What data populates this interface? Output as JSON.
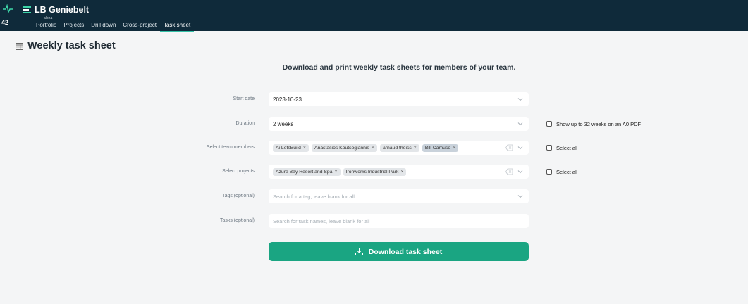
{
  "topbar": {
    "badge": "42",
    "brand": "LB Geniebelt",
    "nav": [
      {
        "label": "Portfolio",
        "tag": "alpha"
      },
      {
        "label": "Projects"
      },
      {
        "label": "Drill down"
      },
      {
        "label": "Cross-project"
      },
      {
        "label": "Task sheet"
      }
    ],
    "active_index": 4
  },
  "header": {
    "title": "Weekly task sheet",
    "subtitle": "Download and print weekly task sheets for members of your team."
  },
  "form": {
    "start_date": {
      "label": "Start date",
      "value": "2023-10-23"
    },
    "duration": {
      "label": "Duration",
      "value": "2 weeks",
      "option_label": "Show up to 32 weeks on an A0 PDF"
    },
    "team_members": {
      "label": "Select team members",
      "chips": [
        "Ai LetsBuild",
        "Anastasios Koutsogiannis",
        "arnaud theiss",
        "Bill Camuso"
      ],
      "select_all_label": "Select all"
    },
    "projects": {
      "label": "Select projects",
      "chips": [
        "Azure Bay Resort and Spa",
        "Ironworks Industrial Park"
      ],
      "select_all_label": "Select all"
    },
    "tags": {
      "label": "Tags (optional)",
      "placeholder": "Search for a tag, leave blank for all"
    },
    "tasks": {
      "label": "Tasks (optional)",
      "placeholder": "Search for task names, leave blank for all"
    }
  },
  "download": {
    "label": "Download task sheet"
  },
  "colors": {
    "topbar": "#0f2a3a",
    "accent": "#1aa582",
    "active_tab_underline": "#33c0a6"
  }
}
